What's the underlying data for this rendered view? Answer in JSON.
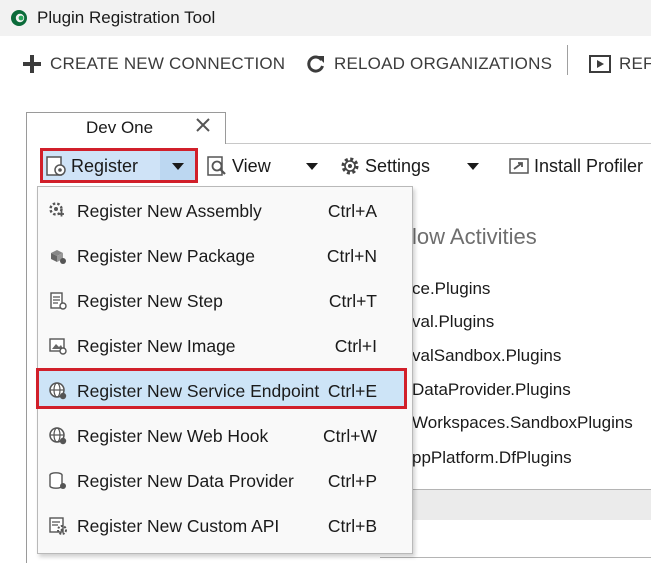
{
  "window": {
    "title": "Plugin Registration Tool",
    "icon": "dataverse-logo-icon"
  },
  "toolbar": {
    "create_connection": "CREATE NEW CONNECTION",
    "reload_orgs": "RELOAD ORGANIZATIONS",
    "replay_partial": "REF"
  },
  "tab": {
    "label": "Dev One"
  },
  "subtoolbar": {
    "register": "Register",
    "view": "View",
    "settings": "Settings",
    "install_profiler": "Install Profiler"
  },
  "background": {
    "heading_partial": "low Activities",
    "items": [
      "ce.Plugins",
      "val.Plugins",
      "valSandbox.Plugins",
      "DataProvider.Plugins",
      "Workspaces.SandboxPlugins",
      "ppPlatform.DfPlugins"
    ]
  },
  "menu": {
    "items": [
      {
        "label": "Register New Assembly",
        "shortcut": "Ctrl+A",
        "icon": "assembly-gear-icon"
      },
      {
        "label": "Register New Package",
        "shortcut": "Ctrl+N",
        "icon": "package-icon"
      },
      {
        "label": "Register New Step",
        "shortcut": "Ctrl+T",
        "icon": "step-document-icon"
      },
      {
        "label": "Register New Image",
        "shortcut": "Ctrl+I",
        "icon": "image-icon"
      },
      {
        "label": "Register New Service Endpoint",
        "shortcut": "Ctrl+E",
        "icon": "globe-endpoint-icon"
      },
      {
        "label": "Register New Web Hook",
        "shortcut": "Ctrl+W",
        "icon": "globe-webhook-icon"
      },
      {
        "label": "Register New Data Provider",
        "shortcut": "Ctrl+P",
        "icon": "database-icon"
      },
      {
        "label": "Register New Custom API",
        "shortcut": "Ctrl+B",
        "icon": "api-gear-icon"
      }
    ],
    "highlighted_index": 4
  },
  "colors": {
    "highlight": "#cde4f7",
    "annotation_border": "#d11f2a",
    "split_button": "#bcd7f1"
  }
}
